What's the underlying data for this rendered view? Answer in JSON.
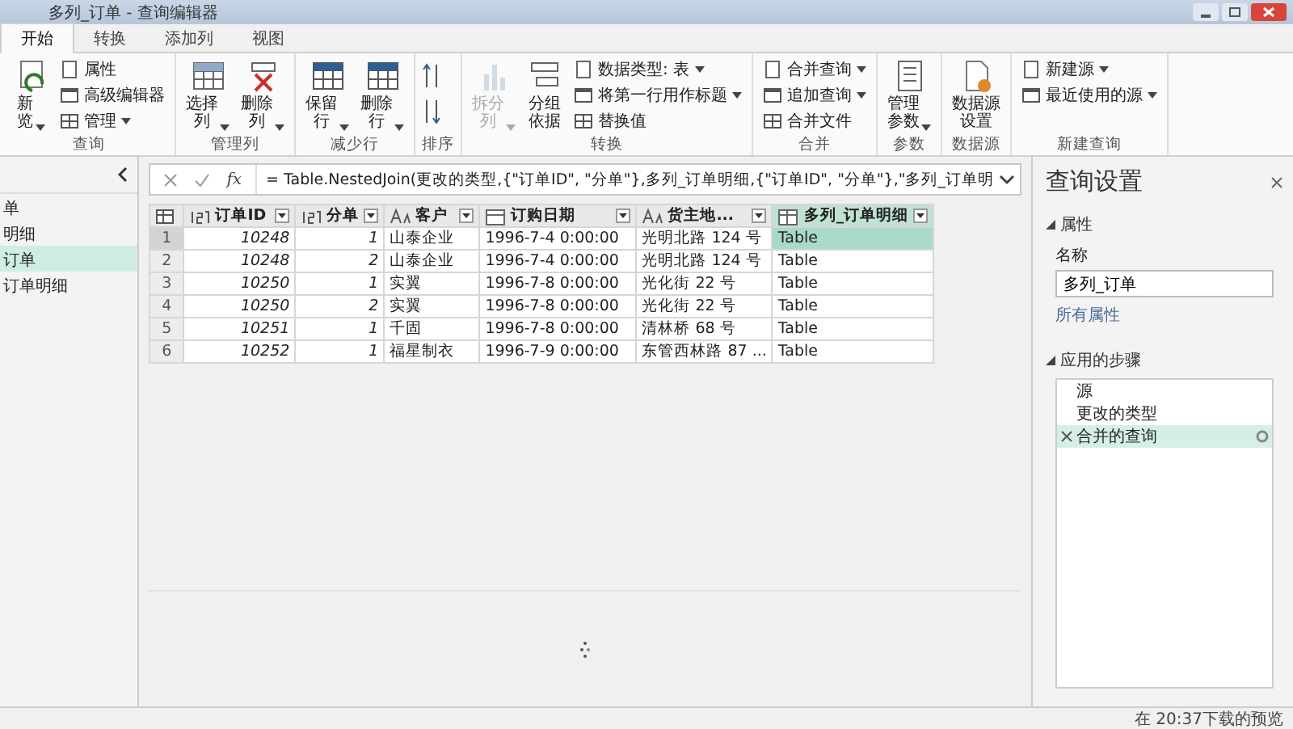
{
  "window": {
    "title": "多列_订单 - 查询编辑器"
  },
  "tabs": [
    {
      "label": "开始",
      "selected": true
    },
    {
      "label": "转换",
      "selected": false
    },
    {
      "label": "添加列",
      "selected": false
    },
    {
      "label": "视图",
      "selected": false
    }
  ],
  "ribbon_groups": [
    {
      "label": "查询",
      "buttons": [
        {
          "kind": "large",
          "label": "新览",
          "dropdown": true,
          "disabled": false
        },
        {
          "kind": "small",
          "label": "属性",
          "dropdown": false,
          "disabled": false
        },
        {
          "kind": "small",
          "label": "高级编辑器",
          "dropdown": false,
          "disabled": false
        },
        {
          "kind": "small",
          "label": "管理",
          "dropdown": true,
          "disabled": false
        }
      ]
    },
    {
      "label": "管理列",
      "buttons": [
        {
          "kind": "large",
          "label": "选择列",
          "dropdown": true,
          "disabled": false
        },
        {
          "kind": "large",
          "label": "删除列",
          "dropdown": true,
          "disabled": false
        }
      ]
    },
    {
      "label": "减少行",
      "buttons": [
        {
          "kind": "large",
          "label": "保留行",
          "dropdown": true,
          "disabled": false
        },
        {
          "kind": "large",
          "label": "删除行",
          "dropdown": true,
          "disabled": false
        }
      ]
    },
    {
      "label": "排序",
      "buttons": [
        {
          "kind": "icon",
          "dropdown": false,
          "disabled": false
        },
        {
          "kind": "icon",
          "dropdown": false,
          "disabled": false
        }
      ]
    },
    {
      "label": "转换",
      "buttons": [
        {
          "kind": "large",
          "label": "拆分列",
          "dropdown": true,
          "disabled": true
        },
        {
          "kind": "large",
          "label": "分组依据",
          "dropdown": false,
          "disabled": false
        },
        {
          "kind": "small",
          "label": "数据类型: 表",
          "dropdown": true,
          "disabled": false
        },
        {
          "kind": "small",
          "label": "将第一行用作标题",
          "dropdown": true,
          "disabled": false
        },
        {
          "kind": "small",
          "label": "替换值",
          "dropdown": false,
          "disabled": false
        }
      ]
    },
    {
      "label": "合并",
      "buttons": [
        {
          "kind": "small",
          "label": "合并查询",
          "dropdown": true,
          "disabled": false
        },
        {
          "kind": "small",
          "label": "追加查询",
          "dropdown": true,
          "disabled": false
        },
        {
          "kind": "small",
          "label": "合并文件",
          "dropdown": false,
          "disabled": false
        }
      ]
    },
    {
      "label": "参数",
      "buttons": [
        {
          "kind": "large",
          "label": "管理参数",
          "dropdown": true,
          "disabled": false
        }
      ]
    },
    {
      "label": "数据源",
      "buttons": [
        {
          "kind": "large",
          "label": "数据源设置",
          "dropdown": false,
          "disabled": false
        }
      ]
    },
    {
      "label": "新建查询",
      "buttons": [
        {
          "kind": "small",
          "label": "新建源",
          "dropdown": true,
          "disabled": false
        },
        {
          "kind": "small",
          "label": "最近使用的源",
          "dropdown": true,
          "disabled": false
        }
      ]
    }
  ],
  "queries": [
    {
      "name": "单",
      "selected": false
    },
    {
      "name": "明细",
      "selected": false
    },
    {
      "name": "订单",
      "selected": true
    },
    {
      "name": "订单明细",
      "selected": false
    }
  ],
  "formula_bar": {
    "fx": "fx",
    "formula": "= Table.NestedJoin(更改的类型,{\"订单ID\", \"分单\"},多列_订单明细,{\"订单ID\", \"分单\"},\"多列_订单明"
  },
  "table": {
    "columns": [
      {
        "name": "订单ID",
        "kind": "number",
        "selected": false
      },
      {
        "name": "分单",
        "kind": "number",
        "selected": false
      },
      {
        "name": "客户",
        "kind": "text",
        "selected": false
      },
      {
        "name": "订购日期",
        "kind": "date",
        "selected": false
      },
      {
        "name": "货主地...",
        "kind": "text",
        "selected": false
      },
      {
        "name": "多列_订单明细",
        "kind": "table",
        "selected": true
      }
    ],
    "rows": [
      {
        "number": "1",
        "selected": true,
        "cells": [
          "10248",
          "1",
          "山泰企业",
          "1996-7-4 0:00:00",
          "光明北路 124 号",
          "Table"
        ]
      },
      {
        "number": "2",
        "selected": false,
        "cells": [
          "10248",
          "2",
          "山泰企业",
          "1996-7-4 0:00:00",
          "光明北路 124 号",
          "Table"
        ]
      },
      {
        "number": "3",
        "selected": false,
        "cells": [
          "10250",
          "1",
          "实翼",
          "1996-7-8 0:00:00",
          "光化街 22 号",
          "Table"
        ]
      },
      {
        "number": "4",
        "selected": false,
        "cells": [
          "10250",
          "2",
          "实翼",
          "1996-7-8 0:00:00",
          "光化街 22 号",
          "Table"
        ]
      },
      {
        "number": "5",
        "selected": false,
        "cells": [
          "10251",
          "1",
          "千固",
          "1996-7-8 0:00:00",
          "清林桥 68 号",
          "Table"
        ]
      },
      {
        "number": "6",
        "selected": false,
        "cells": [
          "10252",
          "1",
          "福星制衣",
          "1996-7-9 0:00:00",
          "东管西林路 87 ...",
          "Table"
        ]
      }
    ]
  },
  "settings": {
    "title": "查询设置",
    "properties": {
      "heading": "属性",
      "expanded": true,
      "name_label": "名称",
      "name_value": "多列_订单",
      "link": "所有属性"
    },
    "steps": {
      "heading": "应用的步骤",
      "expanded": true,
      "items": [
        {
          "name": "源",
          "selected": false
        },
        {
          "name": "更改的类型",
          "selected": false
        },
        {
          "name": "合并的查询",
          "selected": true
        }
      ]
    }
  },
  "status_bar": {
    "text": "在 20:37下载的预览"
  }
}
